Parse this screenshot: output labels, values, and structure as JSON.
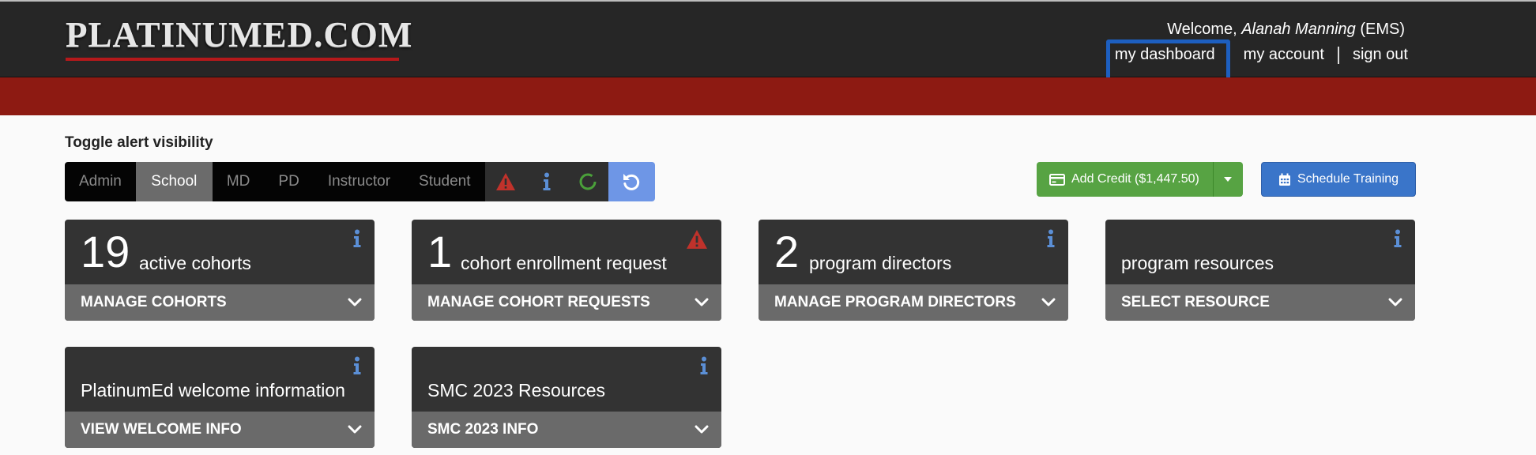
{
  "header": {
    "logo_text": "PLATINUMED.COM",
    "welcome_prefix": "Welcome, ",
    "user_name": "Alanah Manning",
    "user_role": " (EMS)",
    "links": {
      "dashboard": "my dashboard",
      "account": "my account",
      "signout": "sign out"
    }
  },
  "toggle": {
    "title": "Toggle alert visibility",
    "roles": [
      "Admin",
      "School",
      "MD",
      "PD",
      "Instructor",
      "Student"
    ],
    "active_role": "School",
    "icons": [
      "warning-icon",
      "info-icon",
      "circle-icon",
      "refresh-icon"
    ]
  },
  "actions": {
    "add_credit": "Add Credit ($1,447.50)",
    "schedule_training": "Schedule Training"
  },
  "cards": [
    {
      "number": "19",
      "label": "active cohorts",
      "action": "MANAGE COHORTS",
      "icon": "info-icon"
    },
    {
      "number": "1",
      "label": "cohort enrollment request",
      "action": "MANAGE COHORT REQUESTS",
      "icon": "warning-icon"
    },
    {
      "number": "2",
      "label": "program directors",
      "action": "MANAGE PROGRAM DIRECTORS",
      "icon": "info-icon"
    },
    {
      "number": "",
      "label": "program resources",
      "action": "SELECT RESOURCE",
      "icon": "info-icon"
    },
    {
      "number": "",
      "label": "PlatinumEd welcome information",
      "action": "VIEW WELCOME INFO",
      "icon": "info-icon"
    },
    {
      "number": "",
      "label": "SMC 2023 Resources",
      "action": "SMC 2023 INFO",
      "icon": "info-icon"
    }
  ],
  "colors": {
    "header_bg": "#262626",
    "red_band": "#8d1a12",
    "accent_blue": "#1d5fc0",
    "credit_green": "#57a343",
    "schedule_blue": "#3a75c9",
    "warning_red": "#c0322b",
    "info_blue": "#5b8fd6"
  }
}
